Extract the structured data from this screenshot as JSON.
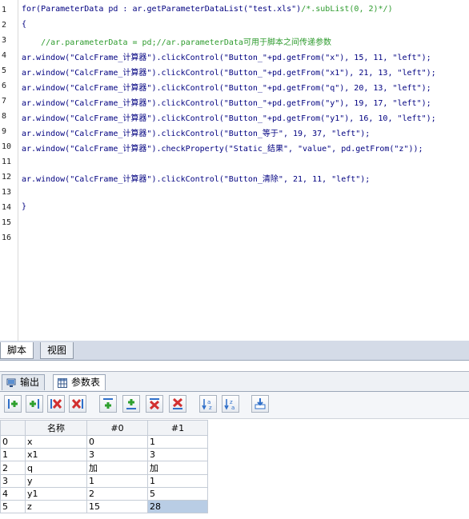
{
  "editor": {
    "lines": [
      {
        "num": "1",
        "text": "for(ParameterData pd : ar.getParameterDataList(\"test.xls\")",
        "comment": "/*.subList(0, 2)*/)"
      },
      {
        "num": "2",
        "text": "{",
        "comment": ""
      },
      {
        "num": "3",
        "text": "    ",
        "comment": "//ar.parameterData = pd;//ar.parameterData可用于脚本之间传递参数"
      },
      {
        "num": "4",
        "text": "ar.window(\"CalcFrame_计算器\").clickControl(\"Button_\"+pd.getFrom(\"x\"), 15, 11, \"left\");",
        "comment": ""
      },
      {
        "num": "5",
        "text": "ar.window(\"CalcFrame_计算器\").clickControl(\"Button_\"+pd.getFrom(\"x1\"), 21, 13, \"left\");",
        "comment": ""
      },
      {
        "num": "6",
        "text": "ar.window(\"CalcFrame_计算器\").clickControl(\"Button_\"+pd.getFrom(\"q\"), 20, 13, \"left\");",
        "comment": ""
      },
      {
        "num": "7",
        "text": "ar.window(\"CalcFrame_计算器\").clickControl(\"Button_\"+pd.getFrom(\"y\"), 19, 17, \"left\");",
        "comment": ""
      },
      {
        "num": "8",
        "text": "ar.window(\"CalcFrame_计算器\").clickControl(\"Button_\"+pd.getFrom(\"y1\"), 16, 10, \"left\");",
        "comment": ""
      },
      {
        "num": "9",
        "text": "ar.window(\"CalcFrame_计算器\").clickControl(\"Button_等于\", 19, 37, \"left\");",
        "comment": ""
      },
      {
        "num": "10",
        "text": "ar.window(\"CalcFrame_计算器\").checkProperty(\"Static_结果\", \"value\", pd.getFrom(\"z\"));",
        "comment": ""
      },
      {
        "num": "11",
        "text": "",
        "comment": ""
      },
      {
        "num": "12",
        "text": "ar.window(\"CalcFrame_计算器\").clickControl(\"Button_清除\", 21, 11, \"left\");",
        "comment": ""
      },
      {
        "num": "13",
        "text": "",
        "comment": ""
      },
      {
        "num": "14",
        "text": "}",
        "comment": ""
      },
      {
        "num": "15",
        "text": "",
        "comment": ""
      },
      {
        "num": "16",
        "text": "",
        "comment": ""
      }
    ]
  },
  "script_tabs": [
    {
      "label": "脚本",
      "active": true
    },
    {
      "label": "视图",
      "active": false
    }
  ],
  "lower_tabs": [
    {
      "label": "输出",
      "icon": "monitor-icon",
      "active": false
    },
    {
      "label": "参数表",
      "icon": "table-icon",
      "active": true
    }
  ],
  "toolbar": [
    {
      "name": "insert-column-before-button",
      "icon": "insert-column-before-icon"
    },
    {
      "name": "insert-column-after-button",
      "icon": "insert-column-after-icon"
    },
    {
      "name": "delete-column-button",
      "icon": "delete-column-icon"
    },
    {
      "name": "delete-column-alt-button",
      "icon": "delete-column-alt-icon"
    },
    {
      "name": "insert-row-above-button",
      "icon": "insert-row-above-icon"
    },
    {
      "name": "insert-row-below-button",
      "icon": "insert-row-below-icon"
    },
    {
      "name": "delete-row-button",
      "icon": "delete-row-icon"
    },
    {
      "name": "delete-row-alt-button",
      "icon": "delete-row-alt-icon"
    },
    {
      "name": "sort-ascending-button",
      "icon": "sort-ascending-icon"
    },
    {
      "name": "sort-descending-button",
      "icon": "sort-descending-icon"
    },
    {
      "name": "import-button",
      "icon": "import-icon"
    }
  ],
  "grid": {
    "headers": [
      "",
      "名称",
      "#0",
      "#1"
    ],
    "rows": [
      [
        "0",
        "x",
        "0",
        "1"
      ],
      [
        "1",
        "x1",
        "3",
        "3"
      ],
      [
        "2",
        "q",
        "加",
        "加"
      ],
      [
        "3",
        "y",
        "1",
        "1"
      ],
      [
        "4",
        "y1",
        "2",
        "5"
      ],
      [
        "5",
        "z",
        "15",
        "28"
      ]
    ],
    "selected_cell": {
      "row": 5,
      "col": 3
    }
  },
  "colors": {
    "code": "#000080",
    "comment": "#2e9b2e",
    "selection": "#b9cde5",
    "add_icon": "#2ea02e",
    "delete_icon": "#d23030",
    "blue_icon": "#2f6fc9"
  }
}
